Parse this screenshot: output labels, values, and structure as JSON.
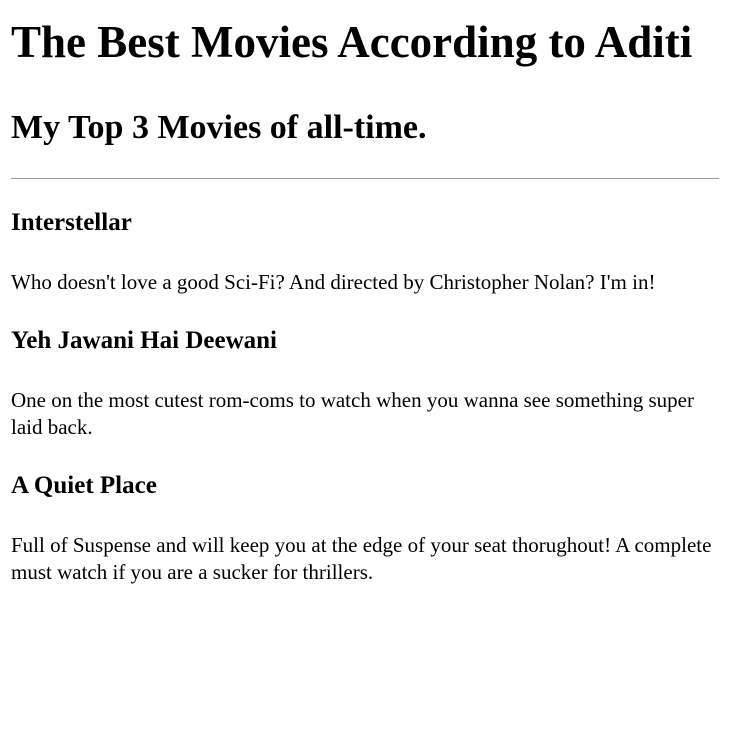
{
  "page": {
    "title": "The Best Movies According to Aditi",
    "subtitle": "My Top 3 Movies of all-time."
  },
  "movies": [
    {
      "title": "Interstellar",
      "description": "Who doesn't love a good Sci-Fi? And directed by Christopher Nolan? I'm in!"
    },
    {
      "title": "Yeh Jawani Hai Deewani",
      "description": "One on the most cutest rom-coms to watch when you wanna see something super laid back."
    },
    {
      "title": "A Quiet Place",
      "description": "Full of Suspense and will keep you at the edge of your seat thorughout! A complete must watch if you are a sucker for thrillers."
    }
  ]
}
